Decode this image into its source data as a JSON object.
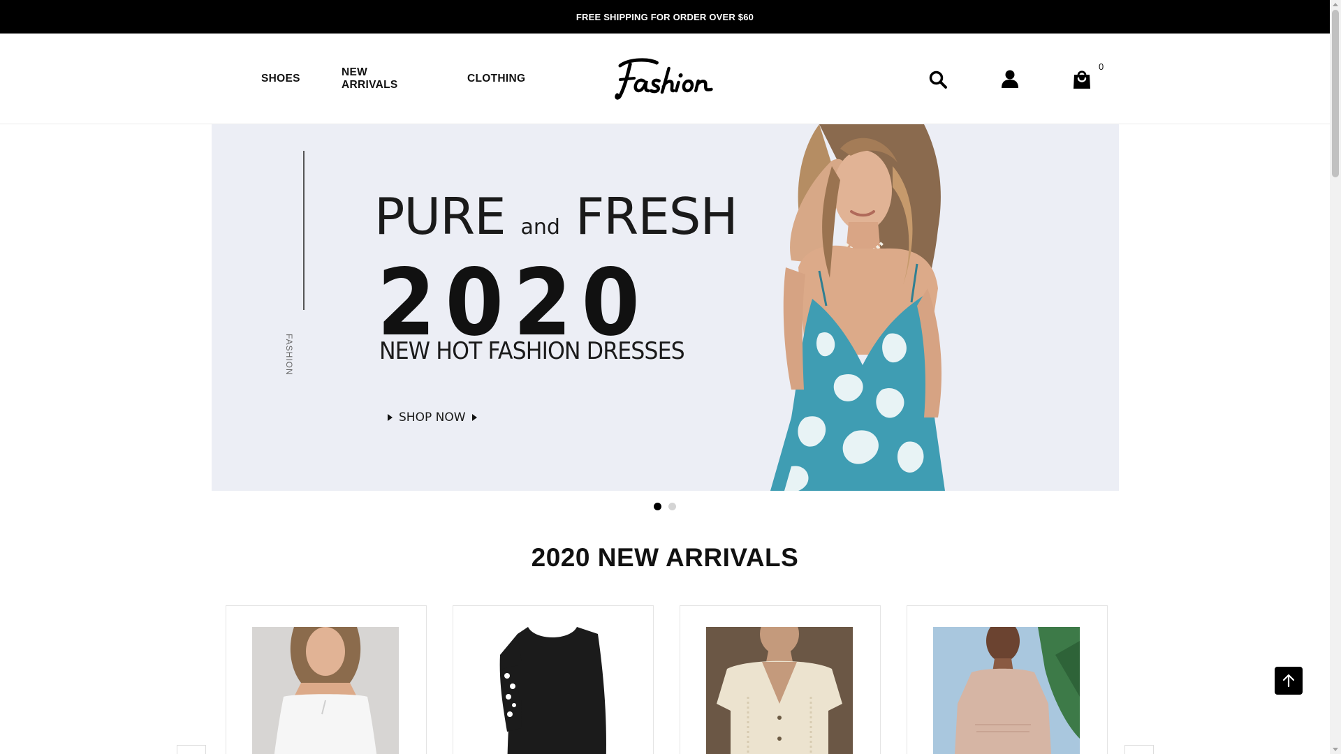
{
  "announcement": "FREE SHIPPING FOR ORDER OVER $60",
  "nav": {
    "items": [
      "SHOES",
      "NEW ARRIVALS",
      "CLOTHING"
    ]
  },
  "logo_text": "Fashion",
  "header_icons": [
    "search-icon",
    "user-icon",
    "shopping-bag-icon"
  ],
  "cart": {
    "count": "0"
  },
  "hero": {
    "side_text": "FASHION",
    "headline_left": "PURE",
    "headline_and": "and",
    "headline_right": "FRESH",
    "year": "2020",
    "subheadline": "NEW HOT FASHION DRESSES",
    "cta": "SHOP NOW",
    "slides_total": 2,
    "active_slide": 1
  },
  "section_title": "2020 NEW ARRIVALS",
  "products": [
    {
      "alt": "white strapless dress",
      "color": "#f2f2f2"
    },
    {
      "alt": "black long sleeve top with white floral print",
      "color": "#1b1b1b"
    },
    {
      "alt": "cream knit button top",
      "color": "#e6ddc9"
    },
    {
      "alt": "nude ribbed long sleeve dress",
      "color": "#d6b5a4"
    }
  ],
  "colors": {
    "topbar": "#000000",
    "hero_bg": "#eceef5",
    "dress": "#3f9db3"
  }
}
